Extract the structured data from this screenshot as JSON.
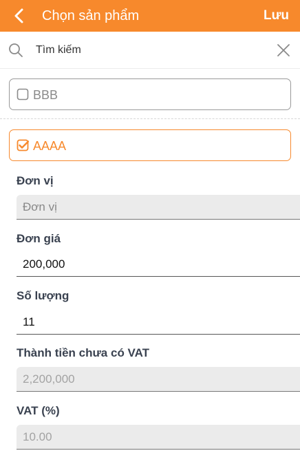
{
  "header": {
    "title": "Chọn sản phẩm",
    "save_label": "Lưu",
    "background": "#f7892c"
  },
  "search": {
    "placeholder": "Tìm kiếm",
    "value": ""
  },
  "products": [
    {
      "label": "BBB",
      "checked": false
    },
    {
      "label": "AAAA",
      "checked": true
    }
  ],
  "form": {
    "unit": {
      "label": "Đơn vị",
      "value": "Đơn vị",
      "disabled": true
    },
    "price": {
      "label": "Đơn giá",
      "value": "200,000",
      "disabled": false
    },
    "quantity": {
      "label": "Số lượng",
      "value": "11",
      "disabled": false
    },
    "subtotal": {
      "label": "Thành tiền chưa có VAT",
      "value": "2,200,000",
      "disabled": true
    },
    "vat": {
      "label": "VAT (%)",
      "value": "10.00",
      "disabled": true
    }
  },
  "colors": {
    "accent": "#f7892c",
    "label": "#3a4250",
    "disabled_bg": "#ebebeb"
  },
  "icons": {
    "back": "chevron-left-icon",
    "search": "search-icon",
    "clear": "close-icon",
    "unchecked": "checkbox-unchecked-icon",
    "checked": "checkbox-checked-icon"
  }
}
